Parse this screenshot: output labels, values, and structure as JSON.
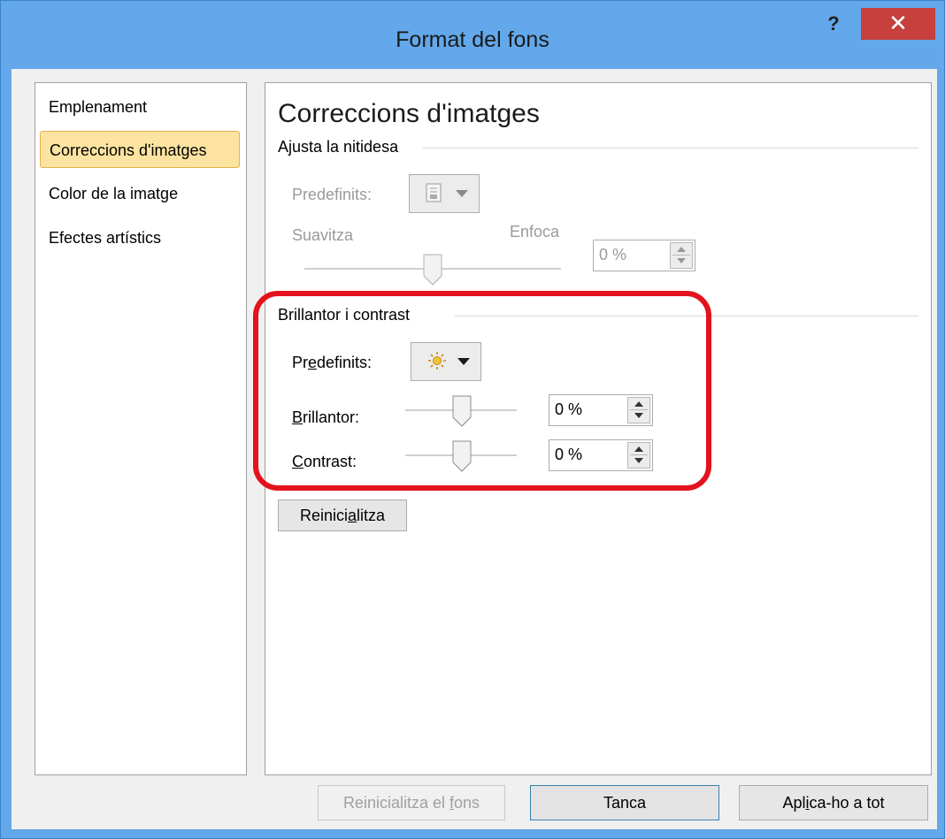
{
  "window": {
    "title": "Format del fons",
    "help_label": "?",
    "close_label": "✕",
    "titlebar_color": "#63a8ea",
    "close_color": "#c7403d"
  },
  "nav": {
    "items": [
      {
        "label": "Emplenament",
        "selected": false
      },
      {
        "label": "Correccions d'imatges",
        "selected": true
      },
      {
        "label": "Color de la imatge",
        "selected": false
      },
      {
        "label": "Efectes artístics",
        "selected": false
      }
    ]
  },
  "panel": {
    "heading": "Correccions d'imatges",
    "sharpness": {
      "section_label": "Ajusta la nitidesa",
      "presets_label": "Predefinits:",
      "presets_icon": "sharpness-preset-icon",
      "soften_label": "Suavitza",
      "sharpen_label": "Enfoca",
      "value": "0 %",
      "enabled": false
    },
    "brightness_contrast": {
      "section_label": "Brillantor i contrast",
      "presets_label": "Predefinits:",
      "presets_icon": "sun-icon",
      "brightness_label": "Brillantor:",
      "brightness_value": "0 %",
      "contrast_label": "Contrast:",
      "contrast_value": "0 %",
      "highlight_color": "#e3121d"
    },
    "reset_label": "Reinicialitza"
  },
  "footer": {
    "reset_background_label": "Reinicialitza el fons",
    "close_label": "Tanca",
    "apply_all_label": "Aplica-ho a tot"
  }
}
